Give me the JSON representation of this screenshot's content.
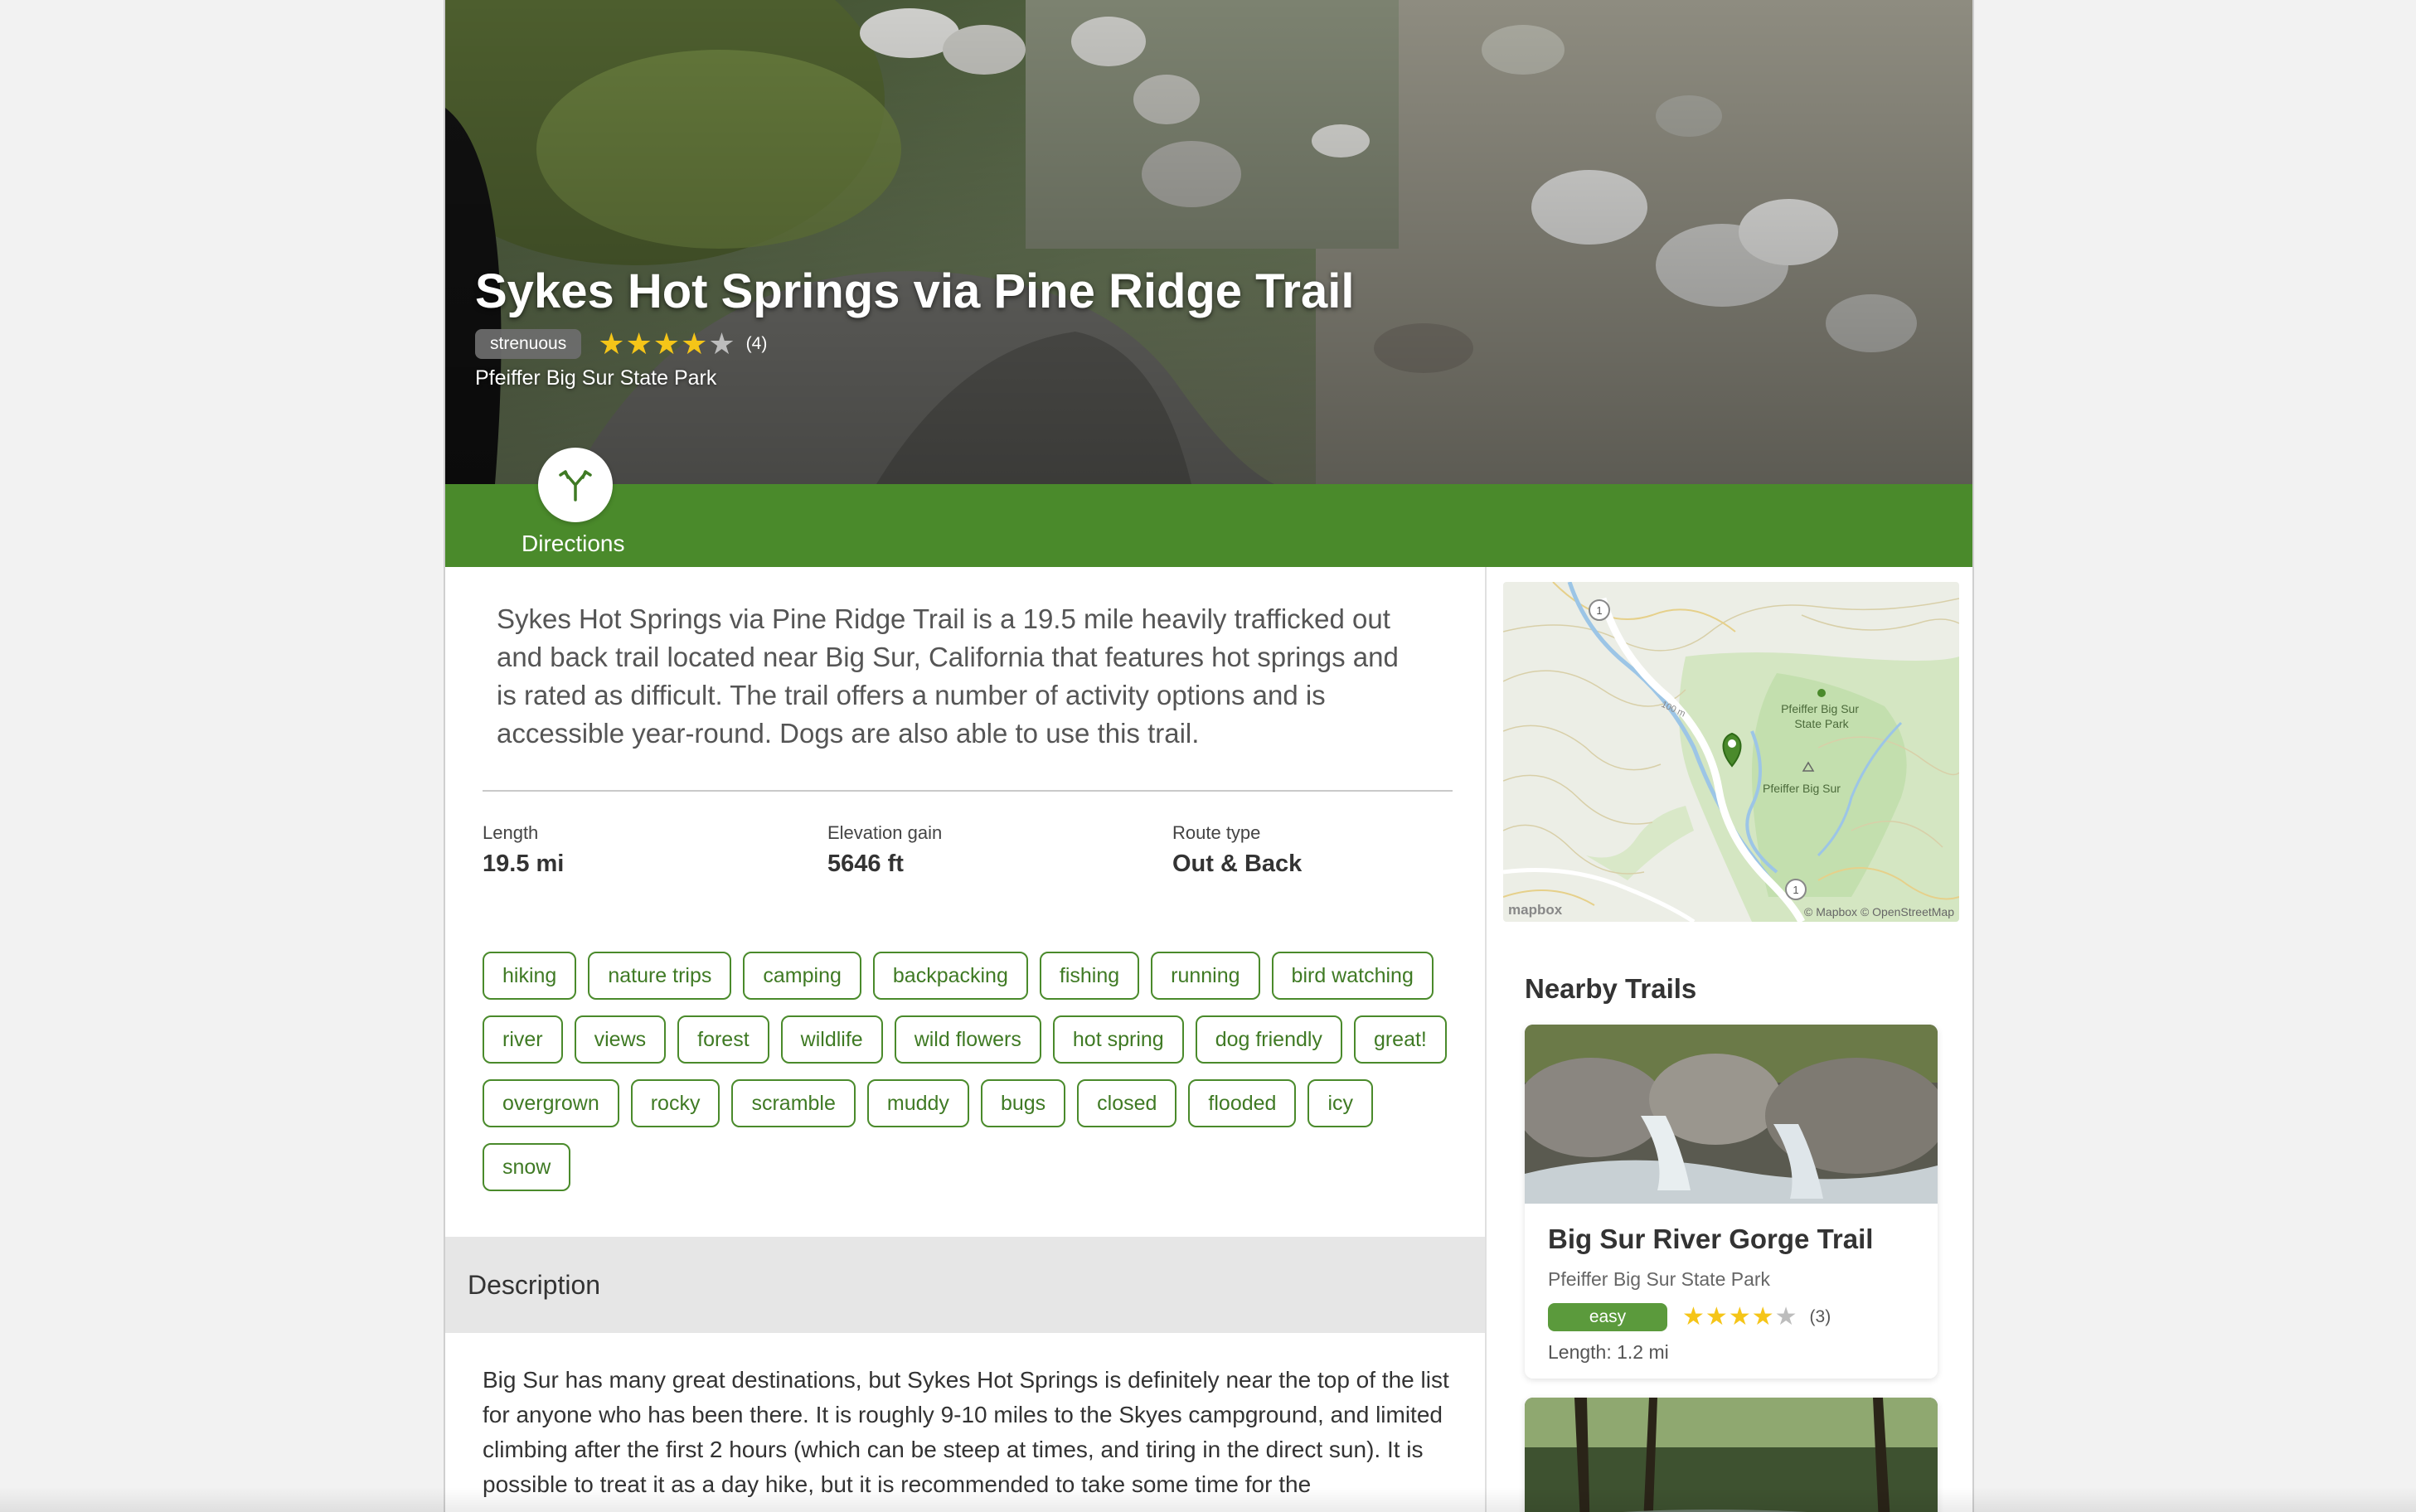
{
  "hero": {
    "title": "Sykes Hot Springs via Pine Ridge Trail",
    "difficulty": "strenuous",
    "rating": 4,
    "rating_count": "(4)",
    "park": "Pfeiffer Big Sur State Park"
  },
  "actions": {
    "directions_label": "Directions",
    "directions_icon": "fork-arrow-icon"
  },
  "summary": "Sykes Hot Springs via Pine Ridge Trail is a 19.5 mile heavily trafficked out and back trail located near Big Sur, California that features hot springs and is rated as difficult. The trail offers a number of activity options and is accessible year-round. Dogs are also able to use this trail.",
  "stats": [
    {
      "label": "Length",
      "value": "19.5 mi"
    },
    {
      "label": "Elevation gain",
      "value": "5646 ft"
    },
    {
      "label": "Route type",
      "value": "Out & Back"
    }
  ],
  "tags": [
    [
      "hiking",
      "nature trips",
      "camping",
      "backpacking",
      "fishing",
      "running",
      "bird watching"
    ],
    [
      "river",
      "views",
      "forest",
      "wildlife",
      "wild flowers",
      "hot spring",
      "dog friendly",
      "great!"
    ],
    [
      "overgrown",
      "rocky",
      "scramble",
      "muddy",
      "bugs",
      "closed",
      "flooded",
      "icy"
    ],
    [
      "snow"
    ]
  ],
  "description": {
    "header": "Description",
    "body": "Big Sur has many great destinations, but Sykes Hot Springs is definitely near the top of the list for anyone who has been there. It is roughly 9-10 miles to the Skyes campground, and limited climbing after the first 2 hours (which can be steep at times, and tiring in the direct sun). It is possible to treat it as a day hike, but it is recommended to take some time for the"
  },
  "map": {
    "label_park": "Pfeiffer Big Sur State Park",
    "label_town": "Pfeiffer Big Sur",
    "route_marker": "1",
    "contour_label": "100 m",
    "logo": "mapbox",
    "attribution": "© Mapbox © OpenStreetMap"
  },
  "nearby": {
    "title": "Nearby Trails",
    "trails": [
      {
        "name": "Big Sur River Gorge Trail",
        "park": "Pfeiffer Big Sur State Park",
        "difficulty": "easy",
        "rating": 4,
        "rating_count": "(3)",
        "length": "Length: 1.2 mi"
      }
    ]
  },
  "colors": {
    "accent_green": "#4a8a2b",
    "star": "#f5c518"
  }
}
